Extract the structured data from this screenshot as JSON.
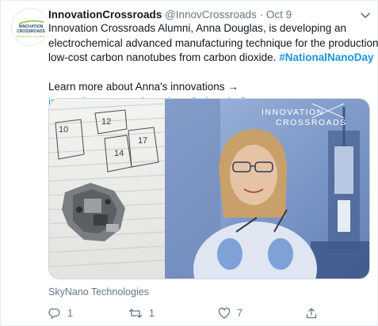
{
  "tweet": {
    "author": {
      "display_name": "InnovationCrossroads",
      "handle": "@InnovCrossroads",
      "separator": "·",
      "date": "Oct 9",
      "avatar_text": "INNOVATION CROSSROADS",
      "avatar_tagline": "Building Nature Generation"
    },
    "text_lines": [
      "Innovation Crossroads Alumni, Anna Douglas, is developing an",
      "electrochemical advanced manufacturing technique for the production of",
      "low-cost carbon nanotubes from carbon dioxide."
    ],
    "hashtag": "#NationalNanoDay",
    "cta_text": "Learn more about Anna's innovations →",
    "link_text": "innovationcrossroads.ornl.gov/index.php/inno...",
    "media": {
      "overlay_title": "INNOVATION",
      "overlay_subtitle": "CROSSROADS",
      "paper_numbers": [
        "10",
        "12",
        "14",
        "17"
      ],
      "caption": "SkyNano Technologies"
    },
    "actions": {
      "reply_count": "1",
      "retweet_count": "1",
      "like_count": "7"
    },
    "colors": {
      "link": "#1b95e0",
      "secondary_text": "#657786",
      "primary_text": "#14171a",
      "photo_tint": "#8ea3c9"
    },
    "icons": [
      "reply-icon",
      "retweet-icon",
      "like-icon",
      "share-icon",
      "chevron-down-icon"
    ]
  }
}
